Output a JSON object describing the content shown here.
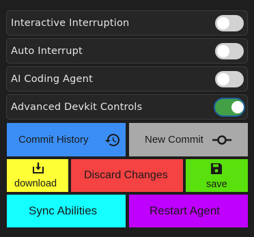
{
  "toggles": [
    {
      "label": "Interactive Interruption",
      "on": false
    },
    {
      "label": "Auto Interrupt",
      "on": false
    },
    {
      "label": "AI Coding Agent",
      "on": false
    },
    {
      "label": "Advanced Devkit Controls",
      "on": true
    }
  ],
  "buttons": {
    "commit_history": {
      "label": "Commit History",
      "icon": "history-icon",
      "color": "#3b8ef5"
    },
    "new_commit": {
      "label": "New Commit",
      "icon": "git-commit-icon",
      "color": "#a9a9a9"
    },
    "download": {
      "label": "download",
      "icon": "download-icon",
      "color": "#ffff36"
    },
    "discard_changes": {
      "label": "Discard Changes",
      "color": "#f54242"
    },
    "save": {
      "label": "save",
      "icon": "save-icon",
      "color": "#5ae00c"
    },
    "sync_abilities": {
      "label": "Sync Abilities",
      "color": "#14ffff"
    },
    "restart_agent": {
      "label": "Restart Agent",
      "color": "#c000ff"
    }
  }
}
